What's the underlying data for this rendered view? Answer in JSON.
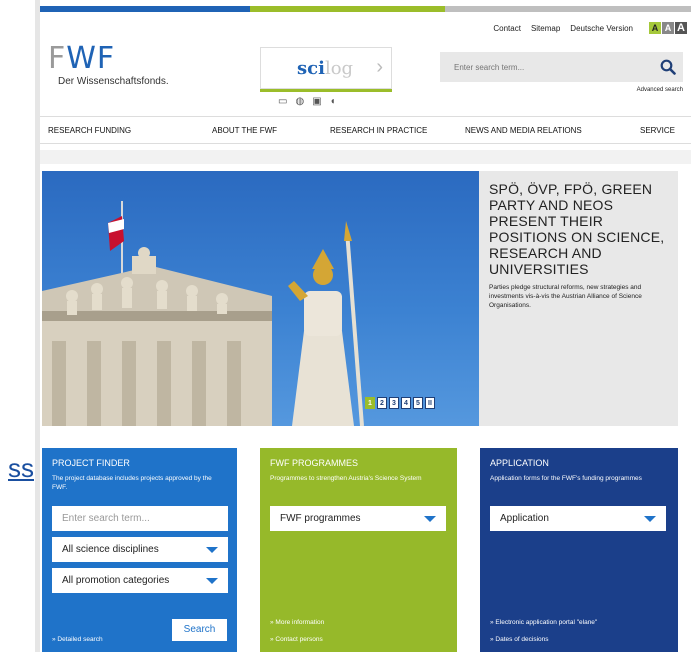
{
  "stray_link": "ss",
  "utility": {
    "contact": "Contact",
    "sitemap": "Sitemap",
    "german": "Deutsche Version",
    "font_sizes": [
      "A",
      "A",
      "A"
    ]
  },
  "logo": {
    "mark": "FWF",
    "subtitle": "Der Wissenschaftsfonds."
  },
  "scilog": {
    "sci": "sci",
    "log": "log"
  },
  "search": {
    "placeholder": "Enter search term...",
    "advanced": "Advanced search"
  },
  "nav": {
    "items": [
      "RESEARCH FUNDING",
      "ABOUT THE FWF",
      "RESEARCH IN PRACTICE",
      "NEWS AND MEDIA RELATIONS",
      "SERVICE"
    ]
  },
  "hero": {
    "title": "SPÖ, ÖVP, FPÖ, GREEN PARTY AND NEOS PRESENT THEIR POSITIONS ON SCIENCE, RESEARCH AND UNIVERSITIES",
    "description": "Parties pledge structural reforms, new strategies and investments vis-à-vis the Austrian Alliance of Science Organisations.",
    "pager": [
      "1",
      "2",
      "3",
      "4",
      "5",
      "II"
    ]
  },
  "boxes": {
    "finder": {
      "title": "PROJECT FINDER",
      "description": "The project database includes projects approved by the FWF.",
      "search_placeholder": "Enter search term...",
      "discipline": "All science disciplines",
      "category": "All promotion categories",
      "detailed_link": "» Detailed search",
      "search_button": "Search"
    },
    "programmes": {
      "title": "FWF PROGRAMMES",
      "description": "Programmes to strengthen Austria's Science System",
      "select": "FWF programmes",
      "link1": "» More information",
      "link2": "» Contact persons"
    },
    "application": {
      "title": "APPLICATION",
      "description": "Application forms for the FWF's funding programmes",
      "select": "Application",
      "link1": "» Electronic application portal \"elane\"",
      "link2": "» Dates of decisions"
    }
  }
}
